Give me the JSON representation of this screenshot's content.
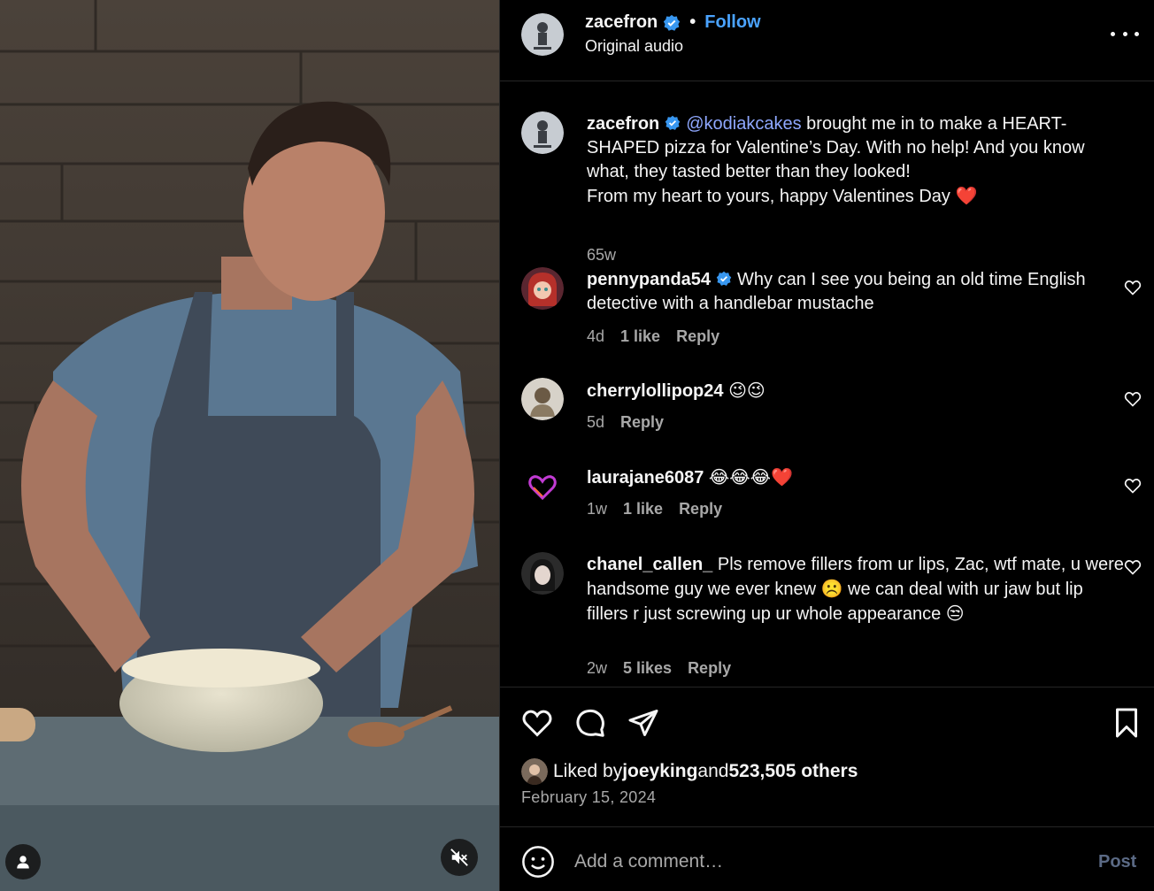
{
  "post": {
    "author": "zacefron",
    "follow_label": "Follow",
    "separator": "•",
    "audio": "Original audio",
    "caption_mention": "@kodiakcakes",
    "caption_lines": [
      " brought me in to make a HEART-SHAPED pizza for Valentine’s Day. With no help! And you know what, they tasted better than they looked!",
      "From my heart to yours, happy Valentines Day "
    ],
    "caption_emoji": "❤️",
    "caption_age": "65w"
  },
  "comments": [
    {
      "user": "pennypanda54",
      "verified": true,
      "text": "Why can I see you being an old time English detective with a handlebar mustache",
      "age": "4d",
      "likes": "1 like",
      "reply": "Reply"
    },
    {
      "user": "cherrylollipop24",
      "verified": false,
      "text": "😉😉",
      "age": "5d",
      "likes": "",
      "reply": "Reply"
    },
    {
      "user": "laurajane6087",
      "verified": false,
      "text": "😂😂😂❤️",
      "age": "1w",
      "likes": "1 like",
      "reply": "Reply"
    },
    {
      "user": "chanel_callen_",
      "verified": false,
      "text_part1": "Pls remove fillers from ur lips, Zac, wtf mate, u were handsome guy we ever knew ",
      "emoji1": "☹️",
      "text_part2": " we can deal with ur jaw but lip fillers r just screwing up ur whole appearance ",
      "emoji2": "😒",
      "age": "2w",
      "likes": "5 likes",
      "reply": "Reply"
    }
  ],
  "likes": {
    "prefix": "Liked by ",
    "user": "joeyking",
    "middle": " and ",
    "count": "523,505 others"
  },
  "date": "February 15, 2024",
  "composer": {
    "placeholder": "Add a comment…",
    "post_label": "Post"
  },
  "colors": {
    "background": "#000000",
    "link_blue": "#4aa3ff",
    "mention": "#8fa8ff",
    "muted_text": "#a8a8a8",
    "verified_badge": "#3897f0"
  }
}
